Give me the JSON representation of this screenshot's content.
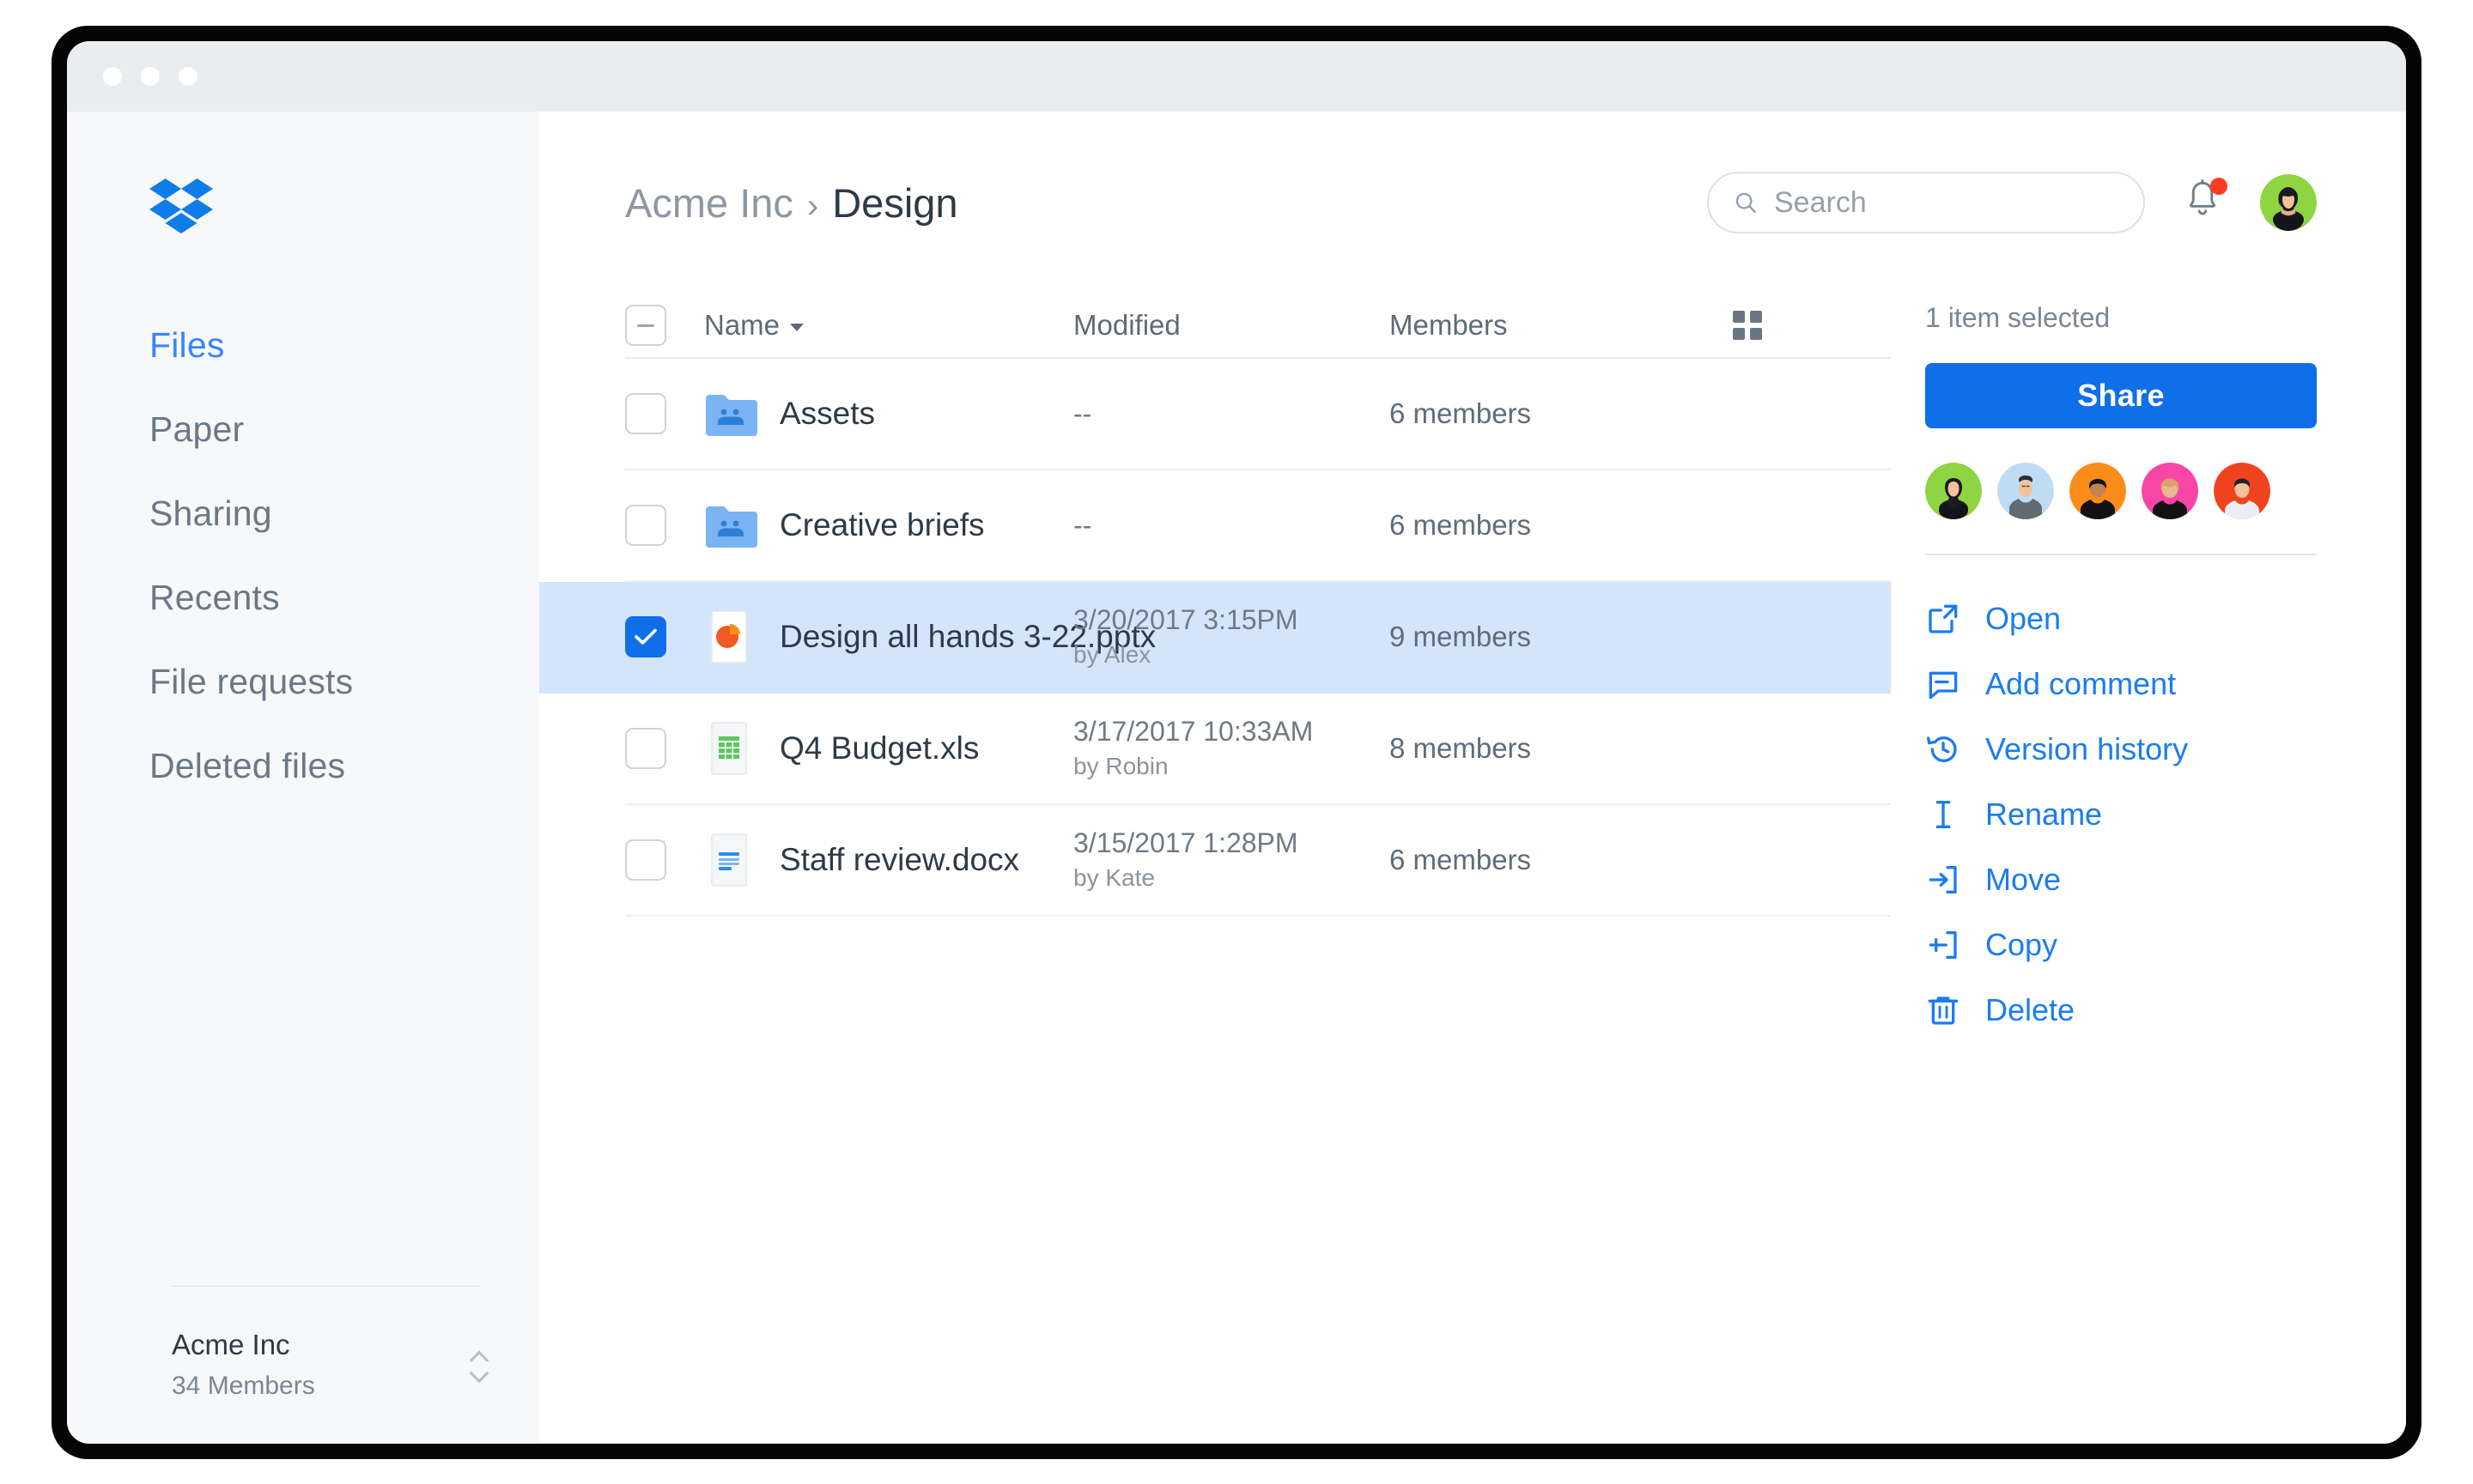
{
  "window": {
    "traffic_lights": [
      "close",
      "minimize",
      "zoom"
    ]
  },
  "sidebar": {
    "logo": "dropbox-logo",
    "items": [
      {
        "label": "Files",
        "active": true
      },
      {
        "label": "Paper",
        "active": false
      },
      {
        "label": "Sharing",
        "active": false
      },
      {
        "label": "Recents",
        "active": false
      },
      {
        "label": "File requests",
        "active": false
      },
      {
        "label": "Deleted files",
        "active": false
      }
    ],
    "team": {
      "name": "Acme Inc",
      "members": "34 Members"
    }
  },
  "header": {
    "breadcrumb": {
      "root": "Acme Inc",
      "separator": "›",
      "current": "Design"
    },
    "search": {
      "placeholder": "Search",
      "value": ""
    },
    "notifications": {
      "has_unread": true
    },
    "avatar_color": "#8fd442"
  },
  "table": {
    "columns": {
      "name": "Name",
      "modified": "Modified",
      "members": "Members"
    },
    "select_all_state": "indeterminate",
    "view_toggle": "grid-view-icon",
    "rows": [
      {
        "name": "Assets",
        "icon": "shared-folder-icon",
        "modified": "--",
        "modified_by": "",
        "members": "6 members",
        "selected": false
      },
      {
        "name": "Creative briefs",
        "icon": "shared-folder-icon",
        "modified": "--",
        "modified_by": "",
        "members": "6 members",
        "selected": false
      },
      {
        "name": "Design all hands 3-22.pptx",
        "icon": "powerpoint-icon",
        "modified": "3/20/2017 3:15PM",
        "modified_by": "by Alex",
        "members": "9 members",
        "selected": true
      },
      {
        "name": "Q4 Budget.xls",
        "icon": "excel-icon",
        "modified": "3/17/2017 10:33AM",
        "modified_by": "by Robin",
        "members": "8 members",
        "selected": false
      },
      {
        "name": "Staff review.docx",
        "icon": "word-icon",
        "modified": "3/15/2017 1:28PM",
        "modified_by": "by Kate",
        "members": "6 members",
        "selected": false
      }
    ]
  },
  "right_panel": {
    "selection_status": "1 item selected",
    "share_label": "Share",
    "member_avatars": [
      {
        "color": "#8fd442"
      },
      {
        "color": "#bedcf3"
      },
      {
        "color": "#fb8c1a"
      },
      {
        "color": "#f945a5"
      },
      {
        "color": "#f0441f"
      }
    ],
    "actions": [
      {
        "label": "Open",
        "icon": "external-link-icon"
      },
      {
        "label": "Add comment",
        "icon": "comment-icon"
      },
      {
        "label": "Version history",
        "icon": "history-icon"
      },
      {
        "label": "Rename",
        "icon": "text-cursor-icon"
      },
      {
        "label": "Move",
        "icon": "move-icon"
      },
      {
        "label": "Copy",
        "icon": "copy-icon"
      },
      {
        "label": "Delete",
        "icon": "trash-icon"
      }
    ]
  },
  "colors": {
    "accent": "#0f6fe8",
    "link": "#1b7cf0",
    "selected_row": "#d4e5fb",
    "sidebar_bg": "#f6f8f9",
    "notification_dot": "#ff3b21"
  }
}
